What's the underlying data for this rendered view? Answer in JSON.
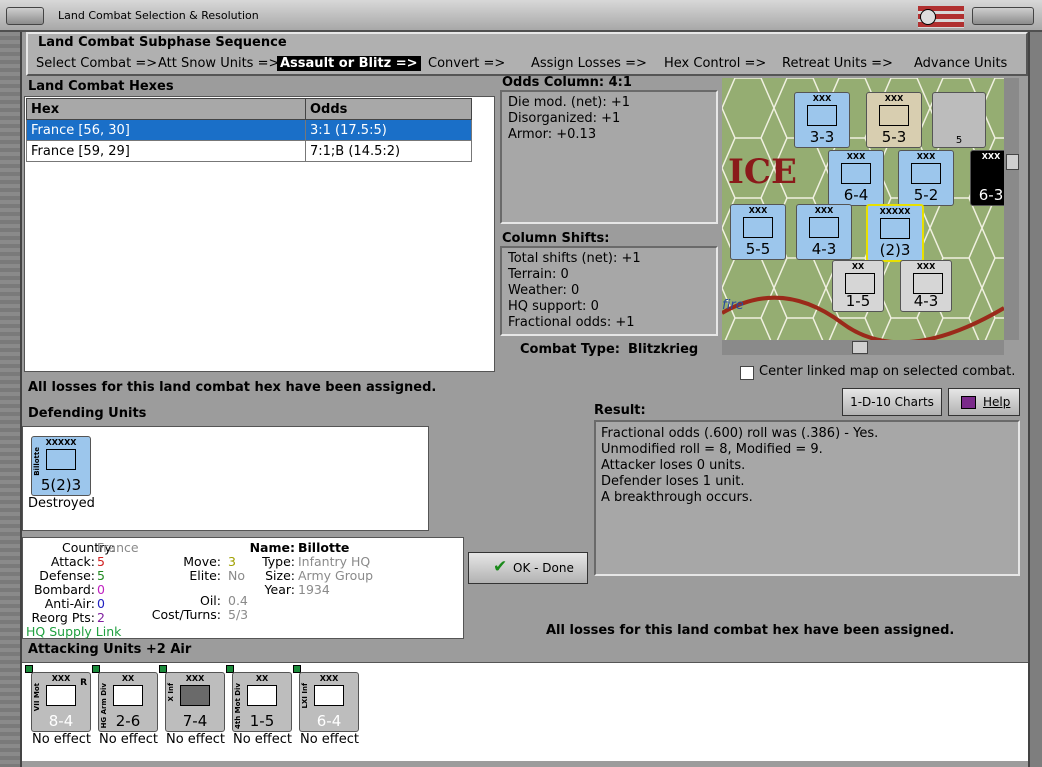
{
  "window": {
    "title": "Land Combat Selection & Resolution"
  },
  "sequence": {
    "title": "Land Combat Subphase Sequence",
    "steps": [
      "Select Combat =>",
      "Att Snow Units =>",
      "Assault or Blitz =>",
      "Convert =>",
      "Assign Losses =>",
      "Hex Control =>",
      "Retreat Units =>",
      "Advance Units"
    ]
  },
  "hexes": {
    "label": "Land Combat Hexes",
    "columns": [
      "Hex",
      "Odds"
    ],
    "rows": [
      {
        "hex": "France [56, 30]",
        "odds": "3:1 (17.5:5)"
      },
      {
        "hex": "France [59, 29]",
        "odds": "7:1;B (14.5:2)"
      }
    ]
  },
  "odds": {
    "title": "Odds Column: 4:1",
    "lines": [
      "Die mod. (net): +1",
      "Disorganized: +1",
      "Armor: +0.13"
    ]
  },
  "shifts": {
    "title": "Column Shifts:",
    "lines": [
      "Total shifts (net): +1",
      "Terrain: 0",
      "Weather: 0",
      "HQ support: 0",
      "Fractional odds: +1"
    ]
  },
  "combat_type": {
    "label": "Combat Type:",
    "value": "Blitzkrieg"
  },
  "center_linked": "Center linked map on selected combat.",
  "losses_msg": "All losses for this land combat hex have been assigned.",
  "buttons": {
    "charts": "1-D-10 Charts",
    "help": "Help",
    "done": "OK - Done"
  },
  "defending": {
    "label": "Defending Units",
    "unit": {
      "size": "XXXXX",
      "name": "Billotte",
      "strength": "5(2)3",
      "status": "Destroyed"
    }
  },
  "result": {
    "label": "Result:",
    "lines": [
      "Fractional odds (.600) roll was (.386)  - Yes.",
      "Unmodified roll = 8, Modified = 9.",
      "Attacker loses 0 units.",
      "Defender loses 1 unit.",
      "A breakthrough occurs."
    ]
  },
  "info": {
    "country_lbl": "Country:",
    "country": "France",
    "attack_lbl": "Attack:",
    "attack": "5",
    "defense_lbl": "Defense:",
    "defense": "5",
    "bombard_lbl": "Bombard:",
    "bombard": "0",
    "antiair_lbl": "Anti-Air:",
    "antiair": "0",
    "reorg_lbl": "Reorg Pts:",
    "reorg": "2",
    "hq_link": "HQ Supply Link",
    "move_lbl": "Move:",
    "move": "3",
    "elite_lbl": "Elite:",
    "elite": "No",
    "oil_lbl": "Oil:",
    "oil": "0.4",
    "cost_lbl": "Cost/Turns:",
    "cost": "5/3",
    "name_lbl": "Name:",
    "name": "Billotte",
    "type_lbl": "Type:",
    "type": "Infantry HQ",
    "size_lbl": "Size:",
    "size": "Army Group",
    "year_lbl": "Year:",
    "year": "1934"
  },
  "attacking": {
    "label": "Attacking Units +2 Air",
    "units": [
      {
        "size": "XXX",
        "name": "VII Mot",
        "strength": "8-4",
        "status": "No effect",
        "r": "R"
      },
      {
        "size": "XX",
        "name": "HG Arm Div",
        "strength": "2-6",
        "status": "No effect",
        "r": ""
      },
      {
        "size": "XXX",
        "name": "X Inf",
        "strength": "7-4",
        "status": "No effect",
        "r": ""
      },
      {
        "size": "XX",
        "name": "4th Mot Div",
        "strength": "1-5",
        "status": "No effect",
        "r": ""
      },
      {
        "size": "XXX",
        "name": "LXI Inf",
        "strength": "6-4",
        "status": "No effect",
        "r": ""
      }
    ]
  },
  "map_counters": [
    {
      "size": "XXX",
      "strength": "3-3"
    },
    {
      "size": "XXX",
      "strength": "5-3"
    },
    {
      "size": "",
      "strength": "5"
    },
    {
      "size": "XXX",
      "strength": "6-4"
    },
    {
      "size": "XXX",
      "strength": "5-2"
    },
    {
      "size": "XXX",
      "strength": "6-3"
    },
    {
      "size": "XXX",
      "strength": "5-5"
    },
    {
      "size": "XXX",
      "strength": "4-3"
    },
    {
      "size": "XXXXX",
      "strength": "(2)3"
    },
    {
      "size": "XX",
      "strength": "1-5"
    },
    {
      "size": "XXX",
      "strength": "4-3"
    }
  ],
  "map_text": {
    "ice": "ICE",
    "fire": "fire"
  }
}
